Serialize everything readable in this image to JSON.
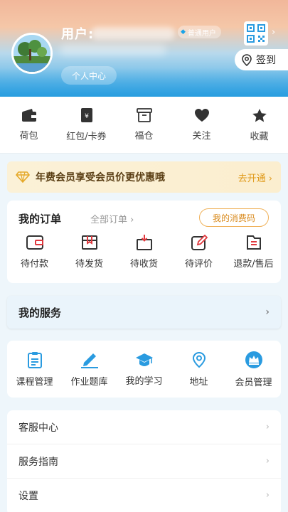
{
  "header": {
    "user_label": "用户:",
    "member_tag": "普通用户",
    "center_button": "个人中心",
    "signin_label": "签到"
  },
  "quickbar": [
    {
      "label": "荷包",
      "icon": "wallet-icon"
    },
    {
      "label": "红包/卡券",
      "icon": "coupon-icon"
    },
    {
      "label": "福仓",
      "icon": "box-icon"
    },
    {
      "label": "关注",
      "icon": "heart-icon"
    },
    {
      "label": "收藏",
      "icon": "star-icon"
    }
  ],
  "vip": {
    "text": "年费会员享受会员价更优惠哦",
    "action": "去开通"
  },
  "orders": {
    "title": "我的订单",
    "all_label": "全部订单",
    "consume_code": "我的消费码",
    "items": [
      {
        "label": "待付款",
        "icon": "pending-payment-icon"
      },
      {
        "label": "待发货",
        "icon": "pending-shipment-icon"
      },
      {
        "label": "待收货",
        "icon": "pending-receipt-icon"
      },
      {
        "label": "待评价",
        "icon": "pending-review-icon"
      },
      {
        "label": "退款/售后",
        "icon": "refund-icon"
      }
    ]
  },
  "services": {
    "title": "我的服务",
    "items": [
      {
        "label": "课程管理",
        "icon": "clipboard-icon"
      },
      {
        "label": "作业题库",
        "icon": "pen-icon"
      },
      {
        "label": "我的学习",
        "icon": "graduation-cap-icon"
      },
      {
        "label": "地址",
        "icon": "location-icon"
      },
      {
        "label": "会员管理",
        "icon": "crown-icon"
      }
    ]
  },
  "list": [
    {
      "label": "客服中心"
    },
    {
      "label": "服务指南"
    },
    {
      "label": "设置"
    }
  ],
  "colors": {
    "accent_blue": "#2a9be0",
    "vip_gold": "#e09a1a",
    "icon_dark": "#333333"
  }
}
